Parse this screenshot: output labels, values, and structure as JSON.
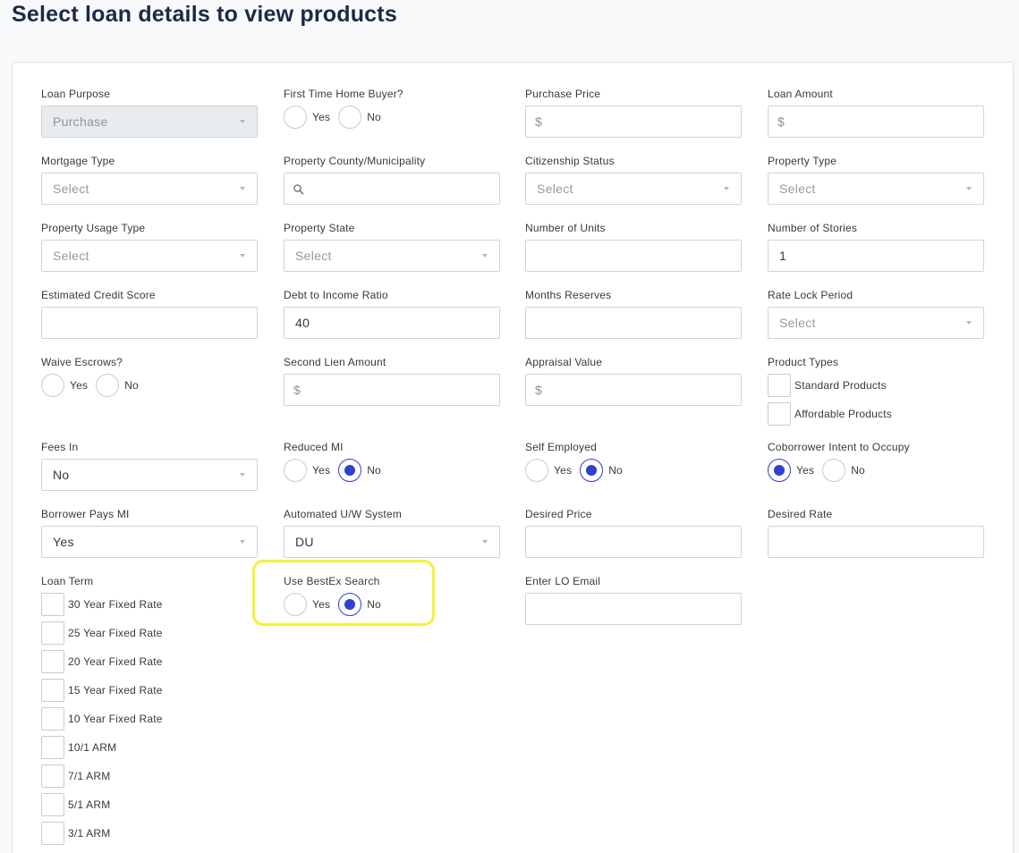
{
  "page": {
    "title": "Select loan details to view products"
  },
  "fields": {
    "loan_purpose": {
      "label": "Loan Purpose",
      "value": "Purchase"
    },
    "first_time_buyer": {
      "label": "First Time Home Buyer?",
      "yes": "Yes",
      "no": "No",
      "selected": "none"
    },
    "purchase_price": {
      "label": "Purchase Price",
      "prefix": "$"
    },
    "loan_amount": {
      "label": "Loan Amount",
      "prefix": "$"
    },
    "mortgage_type": {
      "label": "Mortgage Type",
      "placeholder": "Select"
    },
    "property_county": {
      "label": "Property County/Municipality"
    },
    "citizenship_status": {
      "label": "Citizenship Status",
      "placeholder": "Select"
    },
    "property_type": {
      "label": "Property Type",
      "placeholder": "Select"
    },
    "property_usage_type": {
      "label": "Property Usage Type",
      "placeholder": "Select"
    },
    "property_state": {
      "label": "Property State",
      "placeholder": "Select"
    },
    "number_of_units": {
      "label": "Number of Units"
    },
    "number_of_stories": {
      "label": "Number of Stories",
      "value": "1"
    },
    "estimated_credit_score": {
      "label": "Estimated Credit Score"
    },
    "debt_to_income": {
      "label": "Debt to Income Ratio",
      "value": "40"
    },
    "months_reserves": {
      "label": "Months Reserves"
    },
    "rate_lock_period": {
      "label": "Rate Lock Period",
      "placeholder": "Select"
    },
    "waive_escrows": {
      "label": "Waive Escrows?",
      "yes": "Yes",
      "no": "No",
      "selected": "none"
    },
    "second_lien_amount": {
      "label": "Second Lien Amount",
      "prefix": "$"
    },
    "appraisal_value": {
      "label": "Appraisal Value",
      "prefix": "$"
    },
    "product_types": {
      "label": "Product Types",
      "options": [
        "Standard Products",
        "Affordable Products"
      ]
    },
    "fees_in": {
      "label": "Fees In",
      "value": "No"
    },
    "reduced_mi": {
      "label": "Reduced MI",
      "yes": "Yes",
      "no": "No",
      "selected": "no"
    },
    "self_employed": {
      "label": "Self Employed",
      "yes": "Yes",
      "no": "No",
      "selected": "no"
    },
    "coborrower_intent": {
      "label": "Coborrower Intent to Occupy",
      "yes": "Yes",
      "no": "No",
      "selected": "yes"
    },
    "borrower_pays_mi": {
      "label": "Borrower Pays MI",
      "value": "Yes"
    },
    "automated_uw_system": {
      "label": "Automated U/W System",
      "value": "DU"
    },
    "desired_price": {
      "label": "Desired Price"
    },
    "desired_rate": {
      "label": "Desired Rate"
    },
    "loan_term": {
      "label": "Loan Term",
      "options": [
        "30 Year Fixed Rate",
        "25 Year Fixed Rate",
        "20 Year Fixed Rate",
        "15 Year Fixed Rate",
        "10 Year Fixed Rate",
        "10/1 ARM",
        "7/1 ARM",
        "5/1 ARM",
        "3/1 ARM"
      ]
    },
    "use_bestex_search": {
      "label": "Use BestEx Search",
      "yes": "Yes",
      "no": "No",
      "selected": "no"
    },
    "lo_email": {
      "label": "Enter LO Email"
    }
  },
  "colors": {
    "accent": "#2f3fd1",
    "highlight": "#f2f23a",
    "title": "#1b2a47"
  },
  "icons": {
    "dropdown": "chevron-down-icon",
    "search": "search-icon"
  }
}
